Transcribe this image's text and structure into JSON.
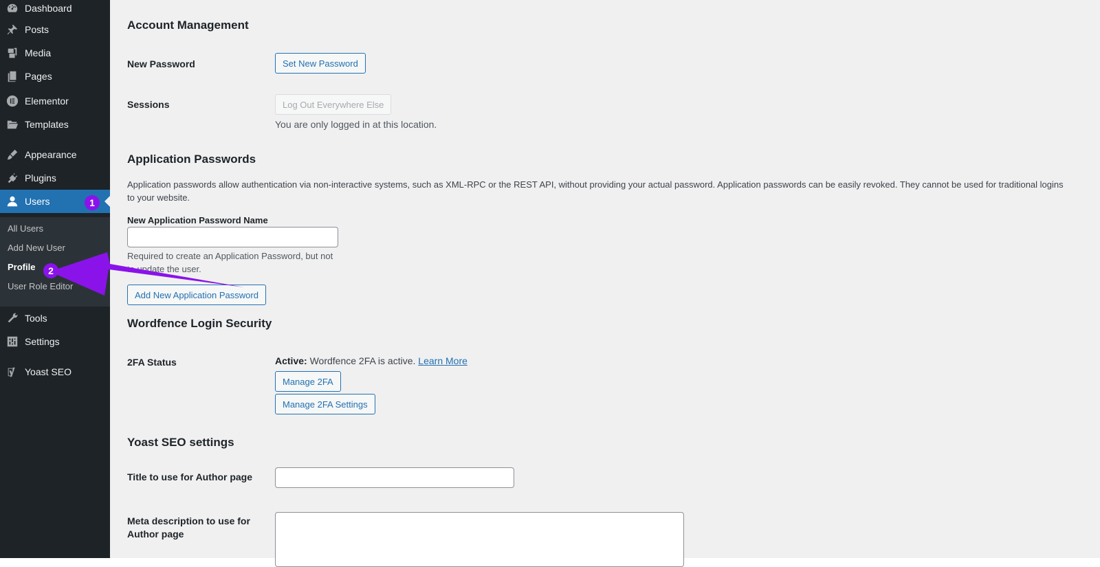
{
  "sidebar": {
    "items": [
      {
        "label": "Dashboard",
        "icon": "dashboard-icon"
      },
      {
        "label": "Posts",
        "icon": "pin-icon"
      },
      {
        "label": "Media",
        "icon": "media-icon"
      },
      {
        "label": "Pages",
        "icon": "pages-icon"
      },
      {
        "label": "Elementor",
        "icon": "elementor-icon"
      },
      {
        "label": "Templates",
        "icon": "folder-icon"
      },
      {
        "label": "Appearance",
        "icon": "brush-icon"
      },
      {
        "label": "Plugins",
        "icon": "plugin-icon"
      },
      {
        "label": "Users",
        "icon": "user-icon"
      },
      {
        "label": "Tools",
        "icon": "wrench-icon"
      },
      {
        "label": "Settings",
        "icon": "settings-icon"
      },
      {
        "label": "Yoast SEO",
        "icon": "yoast-icon"
      }
    ],
    "users_submenu": [
      "All Users",
      "Add New User",
      "Profile",
      "User Role Editor"
    ],
    "current_item": "Users",
    "current_subitem": "Profile"
  },
  "annotations": {
    "badge_1": "1",
    "badge_2": "2",
    "color": "#8a13ea"
  },
  "account_management": {
    "heading": "Account Management",
    "new_password_label": "New Password",
    "set_new_password_button": "Set New Password",
    "sessions_label": "Sessions",
    "logout_everywhere_button": "Log Out Everywhere Else",
    "sessions_note": "You are only logged in at this location."
  },
  "application_passwords": {
    "heading": "Application Passwords",
    "description": "Application passwords allow authentication via non-interactive systems, such as XML-RPC or the REST API, without providing your actual password. Application passwords can be easily revoked. They cannot be used for traditional logins to your website.",
    "name_label": "New Application Password Name",
    "name_value": "",
    "name_help": "Required to create an Application Password, but not to update the user.",
    "add_button": "Add New Application Password"
  },
  "wordfence": {
    "heading": "Wordfence Login Security",
    "status_label": "2FA Status",
    "active_label": "Active:",
    "active_text": "Wordfence 2FA is active.",
    "learn_more": "Learn More",
    "manage_2fa_button": "Manage 2FA",
    "manage_2fa_settings_button": "Manage 2FA Settings"
  },
  "yoast": {
    "heading": "Yoast SEO settings",
    "author_title_label": "Title to use for Author page",
    "author_title_value": "",
    "meta_desc_label": "Meta description to use for Author page",
    "meta_desc_value": ""
  },
  "colors": {
    "sidebar_bg": "#1d2327",
    "accent": "#2271b1",
    "content_bg": "#f0f0f1"
  }
}
